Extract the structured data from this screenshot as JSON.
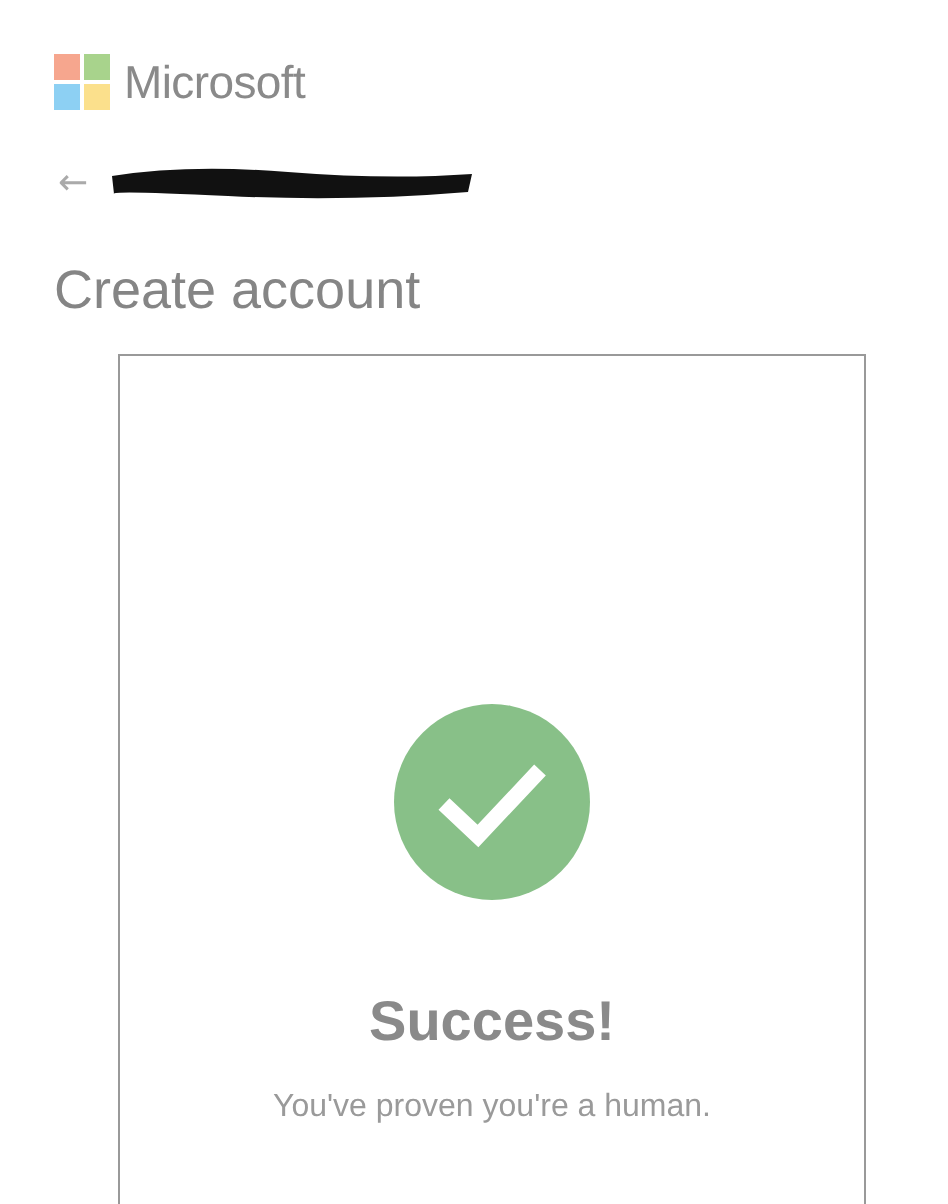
{
  "brand": {
    "name": "Microsoft"
  },
  "header": {
    "back": "←",
    "title": "Create account"
  },
  "result": {
    "succeeded": true,
    "title": "Success!",
    "message": "You've proven you're a human."
  }
}
